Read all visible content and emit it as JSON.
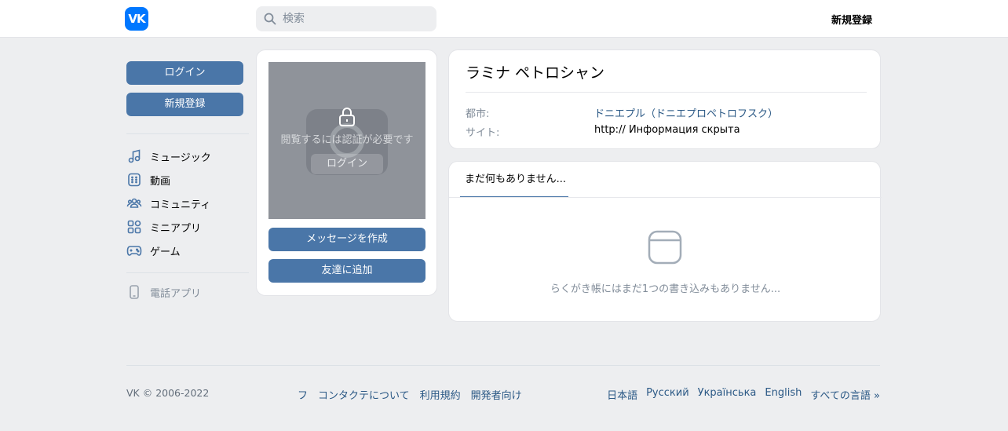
{
  "header": {
    "logo_text": "VK",
    "search_placeholder": "検索",
    "signup_label": "新規登録"
  },
  "sidebar": {
    "login_label": "ログイン",
    "signup_label": "新規登録",
    "items": [
      {
        "label": "ミュージック",
        "icon": "music-icon"
      },
      {
        "label": "動画",
        "icon": "video-icon"
      },
      {
        "label": "コミュニティ",
        "icon": "community-icon"
      },
      {
        "label": "ミニアプリ",
        "icon": "apps-icon"
      },
      {
        "label": "ゲーム",
        "icon": "gamepad-icon"
      }
    ],
    "phone_app_label": "電話アプリ"
  },
  "photo_card": {
    "locked_text": "閲覧するには認証が必要です",
    "login_label": "ログイン",
    "message_label": "メッセージを作成",
    "add_friend_label": "友達に追加"
  },
  "profile": {
    "name": "ラミナ ペトロシャン",
    "city_label": "都市:",
    "city_value": "ドニエプル（ドニエプロペトロフスク）",
    "site_label": "サイト:",
    "site_value": "http:// Информация скрыта"
  },
  "wall": {
    "tab_label": "まだ何もありません...",
    "empty_text": "らくがき帳にはまだ1つの書き込みもありません..."
  },
  "footer": {
    "copyright": "VK © 2006-2022",
    "links": [
      "フ",
      "コンタクテについて",
      "利用規約",
      "開発者向け"
    ],
    "languages": [
      "日本語",
      "Русский",
      "Українська",
      "English",
      "すべての言語 »"
    ]
  },
  "colors": {
    "accent": "#4a76a8",
    "logo": "#0077ff",
    "link": "#2a5885",
    "muted": "#818c99",
    "background": "#edeef0"
  }
}
